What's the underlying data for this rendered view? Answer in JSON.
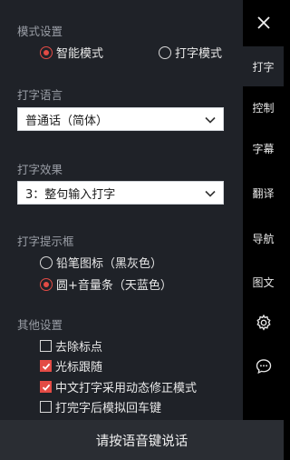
{
  "accent_color": "#e34b45",
  "mode": {
    "title": "模式设置",
    "options": [
      {
        "label": "智能模式",
        "checked": true
      },
      {
        "label": "打字模式",
        "checked": false
      }
    ]
  },
  "language": {
    "title": "打字语言",
    "selected": "普通话（简体）"
  },
  "effect": {
    "title": "打字效果",
    "selected": "3：整句输入打字"
  },
  "hint_box": {
    "title": "打字提示框",
    "options": [
      {
        "label": "铅笔图标（黑灰色）",
        "checked": false
      },
      {
        "label": "圆+音量条（天蓝色）",
        "checked": true
      }
    ]
  },
  "other": {
    "title": "其他设置",
    "options": [
      {
        "label": "去除标点",
        "checked": false
      },
      {
        "label": "光标跟随",
        "checked": true
      },
      {
        "label": "中文打字采用动态修正模式",
        "checked": true
      },
      {
        "label": "打完字后模拟回车键",
        "checked": false
      }
    ]
  },
  "sidebar": {
    "close_icon": "close-icon",
    "tabs": [
      {
        "label": "打字",
        "active": true
      },
      {
        "label": "控制",
        "active": false
      },
      {
        "label": "字幕",
        "active": false
      },
      {
        "label": "翻译",
        "active": false
      },
      {
        "label": "导航",
        "active": false
      },
      {
        "label": "图文",
        "active": false
      }
    ],
    "icons": [
      "gear-icon",
      "chat-bubble-icon"
    ]
  },
  "bottom_bar": {
    "label": "请按语音键说话"
  }
}
